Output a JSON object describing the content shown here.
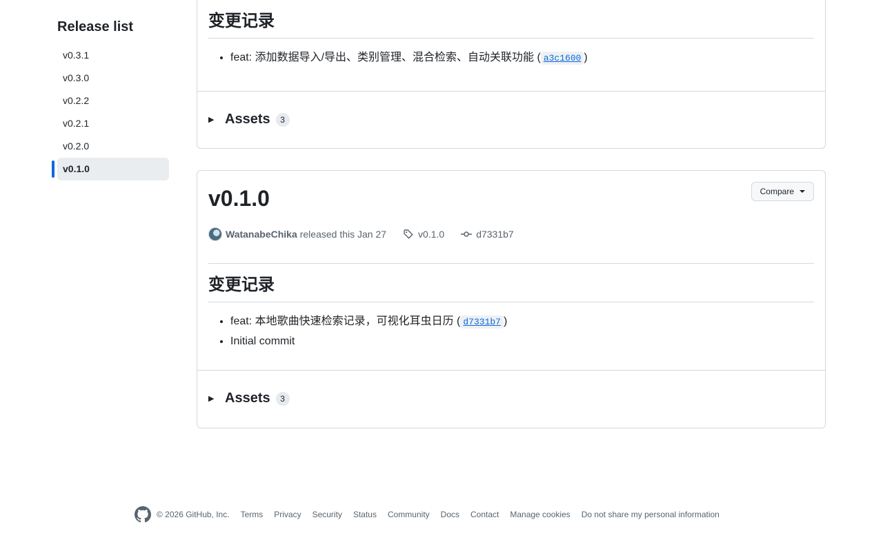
{
  "sidebar": {
    "title": "Release list",
    "items": [
      {
        "label": "v0.3.1",
        "active": false
      },
      {
        "label": "v0.3.0",
        "active": false
      },
      {
        "label": "v0.2.2",
        "active": false
      },
      {
        "label": "v0.2.1",
        "active": false
      },
      {
        "label": "v0.2.0",
        "active": false
      },
      {
        "label": "v0.1.0",
        "active": true
      }
    ]
  },
  "previous_release": {
    "changelog_heading": "变更记录",
    "notes": [
      {
        "text": "feat: 添加数据导入/导出、类别管理、混合检索、自动关联功能",
        "commit": "a3c1600"
      }
    ],
    "assets_label": "Assets",
    "assets_count": "3"
  },
  "release": {
    "title": "v0.1.0",
    "compare_label": "Compare",
    "author": "WatanabeChika",
    "released_text": "released this Jan 27",
    "tag": "v0.1.0",
    "commit": "d7331b7",
    "changelog_heading": "变更记录",
    "notes": [
      {
        "text": "feat: 本地歌曲快速检索记录，可视化耳虫日历",
        "commit": "d7331b7"
      },
      {
        "text": "Initial commit"
      }
    ],
    "assets_label": "Assets",
    "assets_count": "3"
  },
  "footer": {
    "copyright": "© 2026 GitHub, Inc.",
    "links": [
      "Terms",
      "Privacy",
      "Security",
      "Status",
      "Community",
      "Docs",
      "Contact",
      "Manage cookies",
      "Do not share my personal information"
    ]
  },
  "colors": {
    "accent": "#0969da",
    "border": "#d1d9e0",
    "muted": "#59636e"
  }
}
